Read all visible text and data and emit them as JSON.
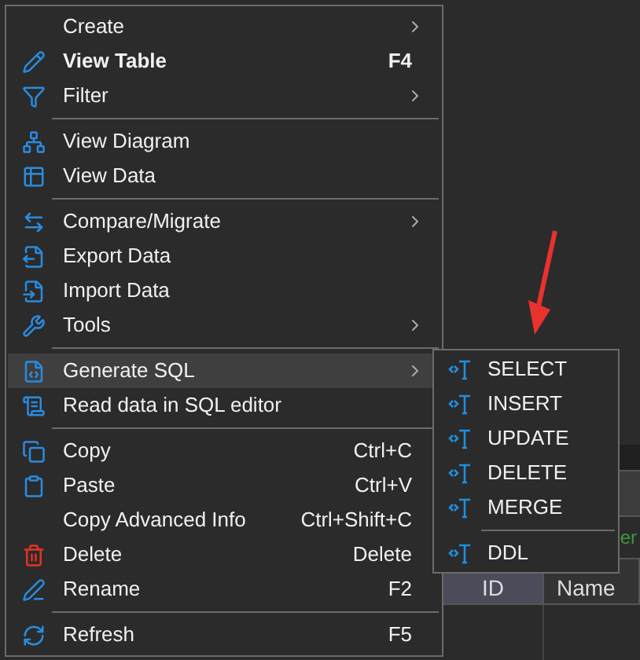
{
  "background": {
    "filter_hint": "er",
    "columns": [
      {
        "label": "ID",
        "selected": true
      },
      {
        "label": "Name",
        "selected": false
      }
    ]
  },
  "context_menu": {
    "groups": [
      [
        {
          "label": "Create",
          "has_submenu": true,
          "default": false,
          "selected": false
        },
        {
          "label": "View Table",
          "shortcut": "F4",
          "has_submenu": false,
          "default": true,
          "selected": false
        },
        {
          "label": "Filter",
          "has_submenu": true,
          "default": false,
          "selected": false
        }
      ],
      [
        {
          "label": "View Diagram",
          "has_submenu": false,
          "default": false,
          "selected": false
        },
        {
          "label": "View Data",
          "has_submenu": false,
          "default": false,
          "selected": false
        }
      ],
      [
        {
          "label": "Compare/Migrate",
          "has_submenu": true,
          "default": false,
          "selected": false
        },
        {
          "label": "Export Data",
          "has_submenu": false,
          "default": false,
          "selected": false
        },
        {
          "label": "Import Data",
          "has_submenu": false,
          "default": false,
          "selected": false
        },
        {
          "label": "Tools",
          "has_submenu": true,
          "default": false,
          "selected": false
        }
      ],
      [
        {
          "label": "Generate SQL",
          "has_submenu": true,
          "default": false,
          "selected": true
        },
        {
          "label": "Read data in SQL editor",
          "has_submenu": false,
          "default": false,
          "selected": false
        }
      ],
      [
        {
          "label": "Copy",
          "shortcut": "Ctrl+C",
          "has_submenu": false,
          "default": false,
          "selected": false
        },
        {
          "label": "Paste",
          "shortcut": "Ctrl+V",
          "has_submenu": false,
          "default": false,
          "selected": false
        },
        {
          "label": "Copy Advanced Info",
          "shortcut": "Ctrl+Shift+C",
          "has_submenu": false,
          "default": false,
          "selected": false
        },
        {
          "label": "Delete",
          "shortcut": "Delete",
          "has_submenu": false,
          "default": false,
          "selected": false
        },
        {
          "label": "Rename",
          "shortcut": "F2",
          "has_submenu": false,
          "default": false,
          "selected": false
        }
      ],
      [
        {
          "label": "Refresh",
          "shortcut": "F5",
          "has_submenu": false,
          "default": false,
          "selected": false
        }
      ]
    ]
  },
  "submenu": {
    "groups": [
      [
        {
          "label": "SELECT"
        },
        {
          "label": "INSERT"
        },
        {
          "label": "UPDATE"
        },
        {
          "label": "DELETE"
        },
        {
          "label": "MERGE"
        }
      ],
      [
        {
          "label": "DDL"
        }
      ]
    ]
  }
}
